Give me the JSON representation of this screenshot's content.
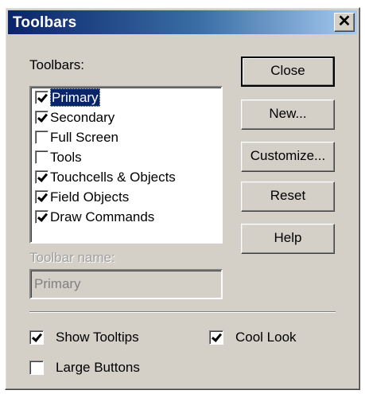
{
  "window": {
    "title": "Toolbars"
  },
  "toolbars_label": "Toolbars:",
  "toolbars_list": [
    {
      "label": "Primary",
      "checked": true,
      "selected": true
    },
    {
      "label": "Secondary",
      "checked": true,
      "selected": false
    },
    {
      "label": "Full Screen",
      "checked": false,
      "selected": false
    },
    {
      "label": "Tools",
      "checked": false,
      "selected": false
    },
    {
      "label": "Touchcells & Objects",
      "checked": true,
      "selected": false
    },
    {
      "label": "Field Objects",
      "checked": true,
      "selected": false
    },
    {
      "label": "Draw Commands",
      "checked": true,
      "selected": false
    }
  ],
  "toolbar_name": {
    "label": "Toolbar name:",
    "value": "Primary"
  },
  "buttons": {
    "close": "Close",
    "new": "New...",
    "customize": "Customize...",
    "reset": "Reset",
    "help": "Help"
  },
  "options": {
    "show_tooltips": {
      "label": "Show Tooltips",
      "checked": true
    },
    "cool_look": {
      "label": "Cool Look",
      "checked": true
    },
    "large_buttons": {
      "label": "Large Buttons",
      "checked": false
    }
  },
  "colors": {
    "titlebar": "#0a246a",
    "selection": "#0a246a",
    "face": "#d4d0c8"
  }
}
